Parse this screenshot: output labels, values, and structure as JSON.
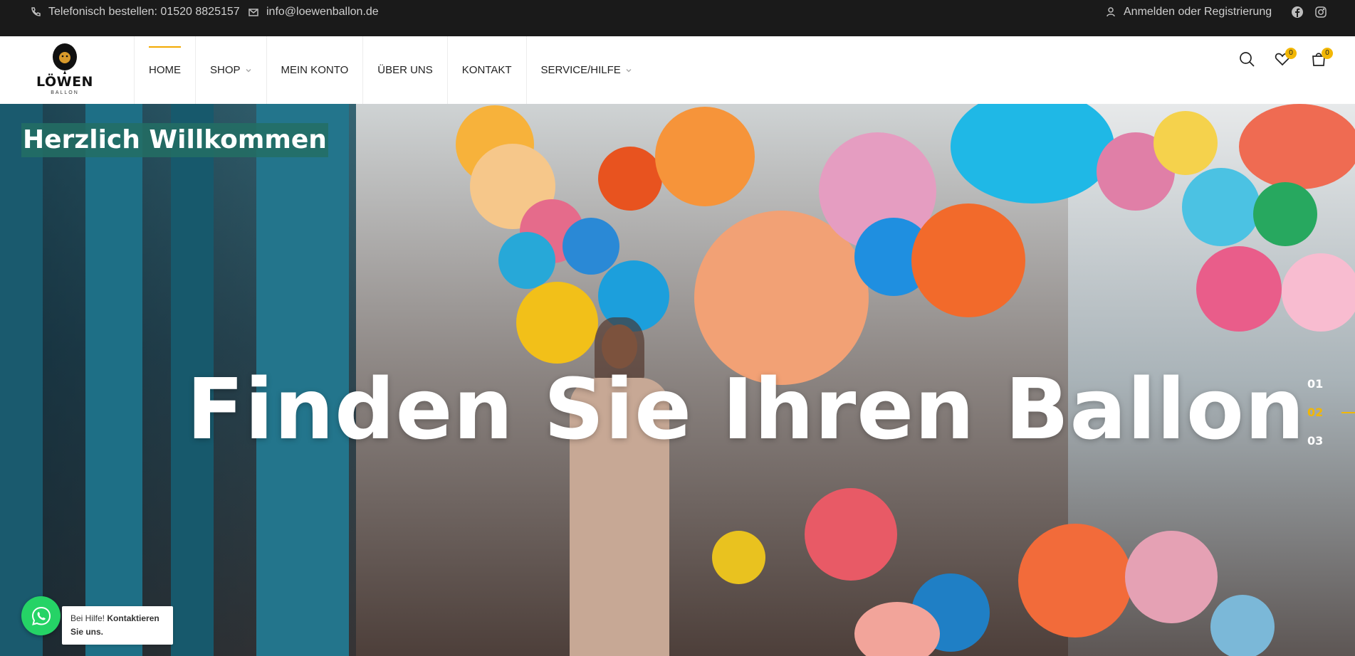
{
  "topbar": {
    "phone_text": "Telefonisch bestellen: 01520 8825157",
    "email_text": "info@loewenballon.de",
    "account_text": "Anmelden oder Registrierung",
    "social": [
      "facebook-icon",
      "instagram-icon"
    ]
  },
  "logo": {
    "name": "LÖWEN",
    "sub": "BALLON"
  },
  "nav": {
    "items": [
      {
        "label": "HOME",
        "active": true,
        "dropdown": false
      },
      {
        "label": "SHOP",
        "active": false,
        "dropdown": true
      },
      {
        "label": "MEIN KONTO",
        "active": false,
        "dropdown": false
      },
      {
        "label": "ÜBER UNS",
        "active": false,
        "dropdown": false
      },
      {
        "label": "KONTAKT",
        "active": false,
        "dropdown": false
      },
      {
        "label": "SERVICE/HILFE",
        "active": false,
        "dropdown": true
      }
    ]
  },
  "header_icons": {
    "wishlist_count": "0",
    "cart_count": "0"
  },
  "hero": {
    "welcome": "Herzlich Willkommen",
    "headline": "Finden Sie Ihren Ballon",
    "slides": [
      "01",
      "02",
      "03"
    ],
    "active_slide": "02"
  },
  "whatsapp": {
    "prefix": "Bei Hilfe!",
    "cta": "Kontaktieren Sie uns."
  },
  "colors": {
    "accent": "#f2b705",
    "topbar_bg": "#1a1a1a",
    "whatsapp": "#25d366"
  }
}
